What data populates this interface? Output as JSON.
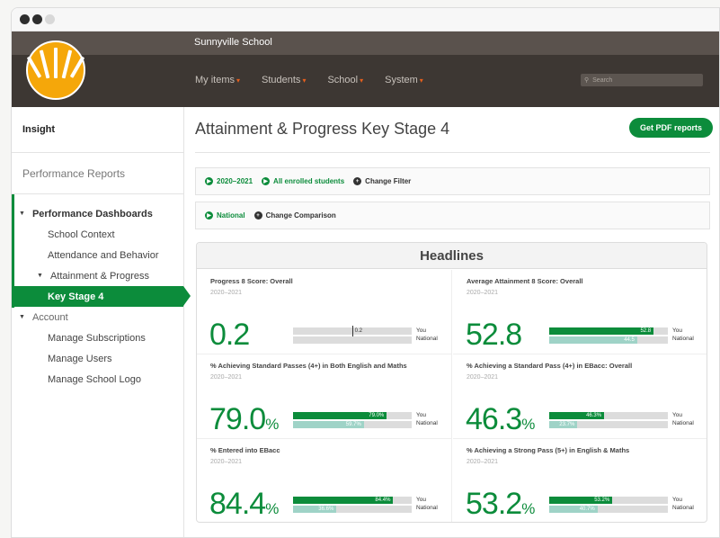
{
  "window": {
    "dots": [
      {
        "color": "#2e2e2e"
      },
      {
        "color": "#2e2e2e"
      },
      {
        "color": "#d8d8d8"
      }
    ]
  },
  "header": {
    "school_name": "Sunnyville School",
    "nav": [
      {
        "label": "My items"
      },
      {
        "label": "Students"
      },
      {
        "label": "School"
      },
      {
        "label": "System"
      }
    ],
    "search_placeholder": "Search",
    "logo_color": "#f5a70a"
  },
  "sidebar": {
    "insight": "Insight",
    "performance_reports": "Performance Reports",
    "tree": [
      {
        "label": "Performance Dashboards",
        "level": 0,
        "expanded": true,
        "bold": true
      },
      {
        "label": "School Context",
        "level": 1
      },
      {
        "label": "Attendance and Behavior",
        "level": 1
      },
      {
        "label": "Attainment & Progress",
        "level": 1,
        "expanded": true
      },
      {
        "label": "Key Stage 4",
        "level": 2,
        "active": true
      },
      {
        "label": "Account",
        "level": 0,
        "expanded": true
      },
      {
        "label": "Manage Subscriptions",
        "level": 1
      },
      {
        "label": "Manage Users",
        "level": 1
      },
      {
        "label": "Manage School Logo",
        "level": 1
      }
    ]
  },
  "main": {
    "title": "Attainment & Progress Key Stage 4",
    "pdf_button": "Get PDF reports",
    "filters": {
      "year": "2020–2021",
      "students": "All enrolled students",
      "change_filter": "Change Filter"
    },
    "comparison": {
      "national": "National",
      "change_comparison": "Change Comparison"
    },
    "headlines": {
      "title": "Headlines",
      "legend_you": "You",
      "legend_national": "National",
      "cells": [
        {
          "label": "Progress 8 Score: Overall",
          "period": "2020–2021",
          "value": "0.2",
          "pct": "",
          "you": 0.2,
          "you_label": "0.2",
          "national": null,
          "national_label": "",
          "type": "progress"
        },
        {
          "label": "Average Attainment 8 Score: Overall",
          "period": "2020–2021",
          "value": "52.8",
          "pct": "",
          "you": 52.8,
          "you_label": "52.8",
          "national": 44.5,
          "national_label": "44.5",
          "type": "score"
        },
        {
          "label": "% Achieving Standard Passes (4+) in Both English and Maths",
          "period": "2020–2021",
          "value": "79.0",
          "pct": "%",
          "you": 79.0,
          "you_label": "79.0%",
          "national": 59.7,
          "national_label": "59.7%",
          "type": "percent"
        },
        {
          "label": "% Achieving a Standard Pass (4+) in EBacc: Overall",
          "period": "2020–2021",
          "value": "46.3",
          "pct": "%",
          "you": 46.3,
          "you_label": "46.3%",
          "national": 23.7,
          "national_label": "23.7%",
          "type": "percent"
        },
        {
          "label": "% Entered into EBacc",
          "period": "2020–2021",
          "value": "84.4",
          "pct": "%",
          "you": 84.4,
          "you_label": "84.4%",
          "national": 36.6,
          "national_label": "36.6%",
          "type": "percent"
        },
        {
          "label": "% Achieving a Strong Pass (5+) in English & Maths",
          "period": "2020–2021",
          "value": "53.2",
          "pct": "%",
          "you": 53.2,
          "you_label": "53.2%",
          "national": 40.7,
          "national_label": "40.7%",
          "type": "percent"
        }
      ]
    }
  }
}
